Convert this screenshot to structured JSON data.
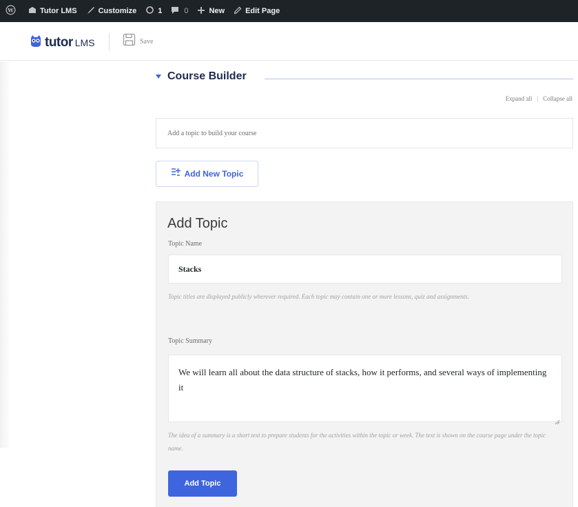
{
  "admin_bar": {
    "site_name": "Tutor LMS",
    "customize": "Customize",
    "updates_count": "1",
    "comments_count": "0",
    "new_label": "New",
    "edit_page": "Edit Page"
  },
  "header": {
    "logo_main": "tutor",
    "logo_sub": "LMS",
    "save_label": "Save"
  },
  "course_builder": {
    "title": "Course Builder",
    "expand_all": "Expand all",
    "separator": "|",
    "collapse_all": "Collapse all",
    "empty_message": "Add a topic to build your course",
    "add_new_topic": "Add New Topic"
  },
  "add_topic_form": {
    "title": "Add Topic",
    "topic_name_label": "Topic Name",
    "topic_name_value": "Stacks",
    "topic_name_help": "Topic titles are displayed publicly wherever required. Each topic may contain one or more lessons, quiz and assignments.",
    "topic_summary_label": "Topic Summary",
    "topic_summary_value": "We will learn all about the data structure of stacks, how it performs, and several ways of implementing it",
    "topic_summary_help": "The idea of a summary is a short text to prepare students for the activities within the topic or week. The text is shown on the course page under the topic name.",
    "submit_label": "Add Topic"
  },
  "colors": {
    "accent": "#3e64de",
    "admin_bar_bg": "#1d2327",
    "panel_bg": "#f3f3f3"
  },
  "icons": {
    "wordpress": "wordpress-icon",
    "dashboard": "dashboard-icon",
    "customize": "brush-icon",
    "updates": "refresh-icon",
    "comments": "comment-icon",
    "new": "plus-icon",
    "edit": "pencil-icon",
    "logo": "tutor-owl-icon",
    "save": "save-file-icon",
    "add_topic": "add-list-icon",
    "caret": "caret-down-icon"
  }
}
